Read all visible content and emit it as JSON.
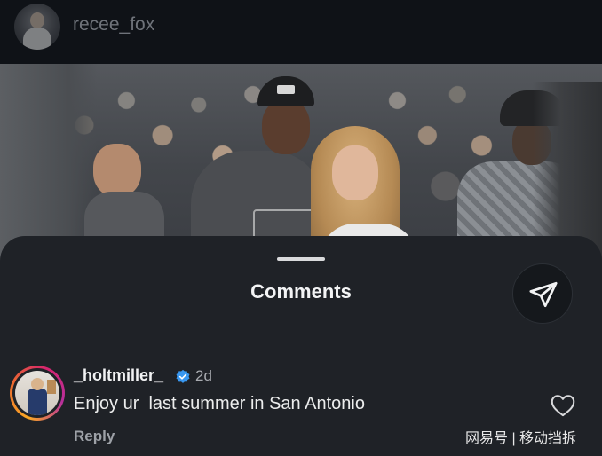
{
  "post": {
    "username": "recee_fox"
  },
  "sheet": {
    "title": "Comments"
  },
  "comment": {
    "username": "_holtmiller_",
    "time": "2d",
    "text": "Enjoy ur  last summer in San Antonio",
    "reply_label": "Reply"
  },
  "watermark": "网易号 | 移动挡拆",
  "colors": {
    "sheet_bg": "#1f2227",
    "verified": "#3897f0",
    "story_ring": "#d6246e"
  },
  "icons": {
    "share": "paper-plane-icon",
    "like": "heart-icon",
    "verified": "verified-badge-icon"
  }
}
